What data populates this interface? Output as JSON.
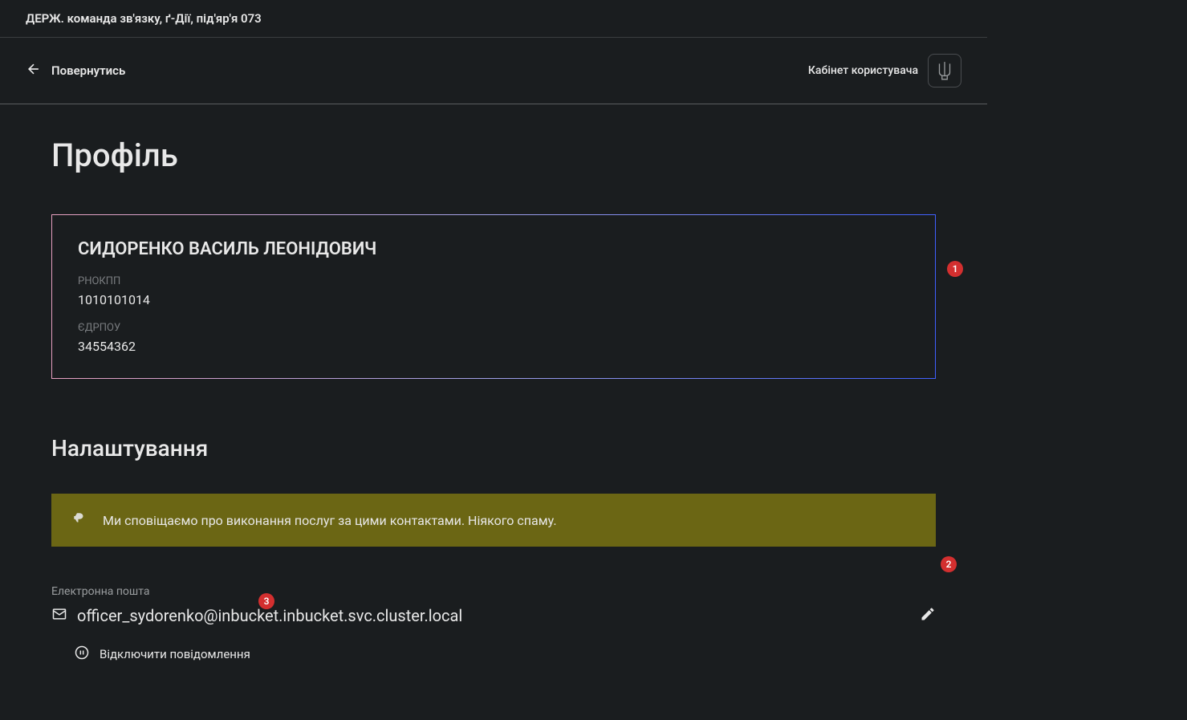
{
  "header": {
    "title": "ДЕРЖ. команда зв'язку, ґ-Дії, під'яр'я 073"
  },
  "toolbar": {
    "back_label": "Повернутись",
    "cabinet_label": "Кабінет користувача"
  },
  "profile": {
    "page_title": "Профіль",
    "name": "СИДОРЕНКО ВАСИЛЬ ЛЕОНІДОВИЧ",
    "fields": [
      {
        "label": "РНОКПП",
        "value": "1010101014"
      },
      {
        "label": "ЄДРПОУ",
        "value": "34554362"
      }
    ]
  },
  "settings": {
    "section_title": "Налаштування",
    "banner_text": "Ми сповіщаємо про виконання послуг за цими контактами. Ніякого спаму.",
    "email_label": "Електронна пошта",
    "email_value": "officer_sydorenko@inbucket.inbucket.svc.cluster.local",
    "disable_notif_label": "Відключити повідомлення"
  },
  "annotations": {
    "badge1": "1",
    "badge2": "2",
    "badge3": "3"
  }
}
